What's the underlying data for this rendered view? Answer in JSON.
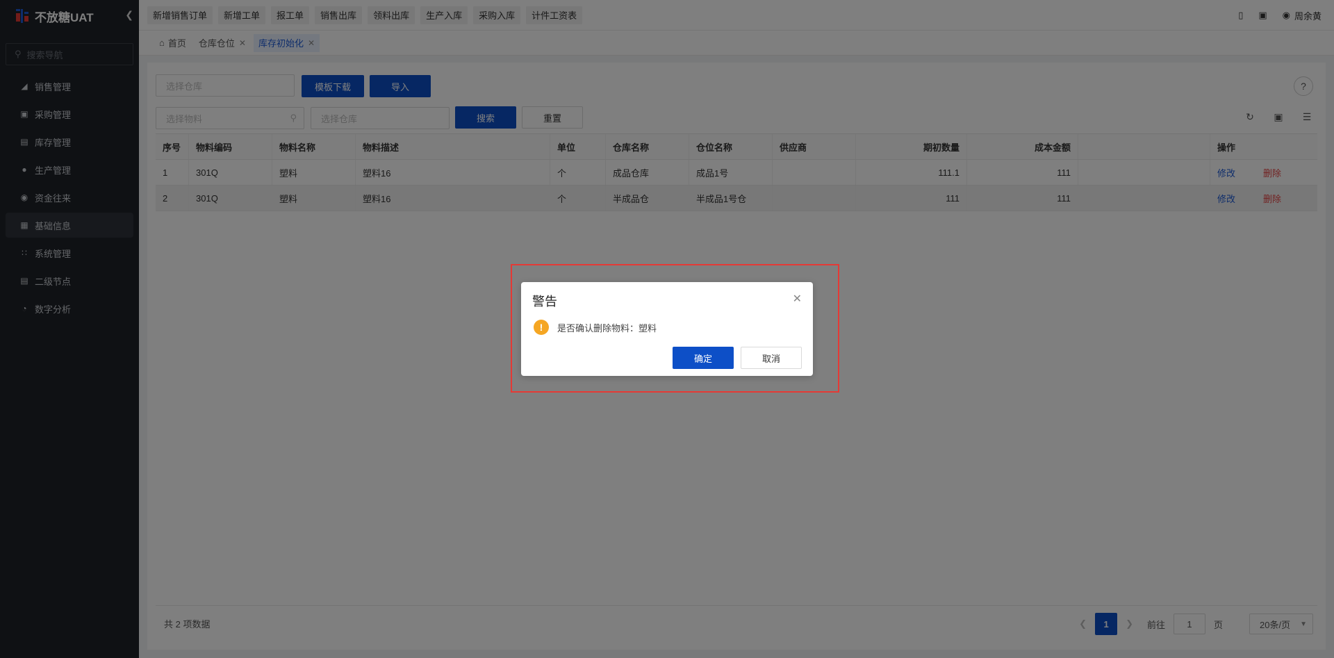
{
  "app": {
    "brand": "不放糖UAT",
    "collapse_icon": "chevron-left-icon"
  },
  "sidebar": {
    "search_placeholder": "搜索导航",
    "items": [
      {
        "label": "销售管理",
        "icon": "tag-icon"
      },
      {
        "label": "采购管理",
        "icon": "cart-icon"
      },
      {
        "label": "库存管理",
        "icon": "box-icon"
      },
      {
        "label": "生产管理",
        "icon": "cluster-icon"
      },
      {
        "label": "资金往来",
        "icon": "money-icon"
      },
      {
        "label": "基础信息",
        "icon": "dashboard-icon"
      },
      {
        "label": "系统管理",
        "icon": "apps-icon"
      },
      {
        "label": "二级节点",
        "icon": "document-icon"
      },
      {
        "label": "数字分析",
        "icon": "pie-icon"
      }
    ],
    "active_item": "基础信息"
  },
  "topbar": {
    "quick_buttons": [
      "新增销售订单",
      "新增工单",
      "报工单",
      "销售出库",
      "领料出库",
      "生产入库",
      "采购入库",
      "计件工资表"
    ],
    "user_name": "周余黄"
  },
  "tabs": {
    "home": "首页",
    "items": [
      {
        "label": "仓库仓位",
        "active": false
      },
      {
        "label": "库存初始化",
        "active": true
      }
    ]
  },
  "filters": {
    "warehouse_placeholder": "选择仓库",
    "material_placeholder": "选择物料",
    "warehouse2_placeholder": "选择仓库",
    "template_download": "模板下载",
    "import": "导入",
    "search": "搜索",
    "reset": "重置"
  },
  "table": {
    "columns": [
      "序号",
      "物料编码",
      "物料名称",
      "物料描述",
      "单位",
      "仓库名称",
      "仓位名称",
      "供应商",
      "期初数量",
      "成本金额",
      "",
      "操作"
    ],
    "rows": [
      {
        "no": "1",
        "code": "301Q",
        "name": "塑料",
        "desc": "塑料16",
        "unit": "个",
        "warehouse": "成品仓库",
        "location": "成品1号",
        "supplier": "",
        "qty": "111.1",
        "cost": "111",
        "edit": "修改",
        "delete": "删除"
      },
      {
        "no": "2",
        "code": "301Q",
        "name": "塑料",
        "desc": "塑料16",
        "unit": "个",
        "warehouse": "半成品仓",
        "location": "半成品1号仓",
        "supplier": "",
        "qty": "111",
        "cost": "111",
        "edit": "修改",
        "delete": "删除"
      }
    ]
  },
  "footer": {
    "total": "共 2 项数据",
    "current_page": "1",
    "goto_label": "前往",
    "goto_value": "1",
    "page_unit": "页",
    "page_size": "20条/页"
  },
  "dialog": {
    "title": "警告",
    "message": "是否确认删除物料：塑料",
    "confirm": "确定",
    "cancel": "取消"
  },
  "colors": {
    "primary": "#0d4fc7",
    "danger": "#e54545",
    "warning": "#f5a623",
    "highlight": "#e53935",
    "sidebar": "#1f2228"
  }
}
